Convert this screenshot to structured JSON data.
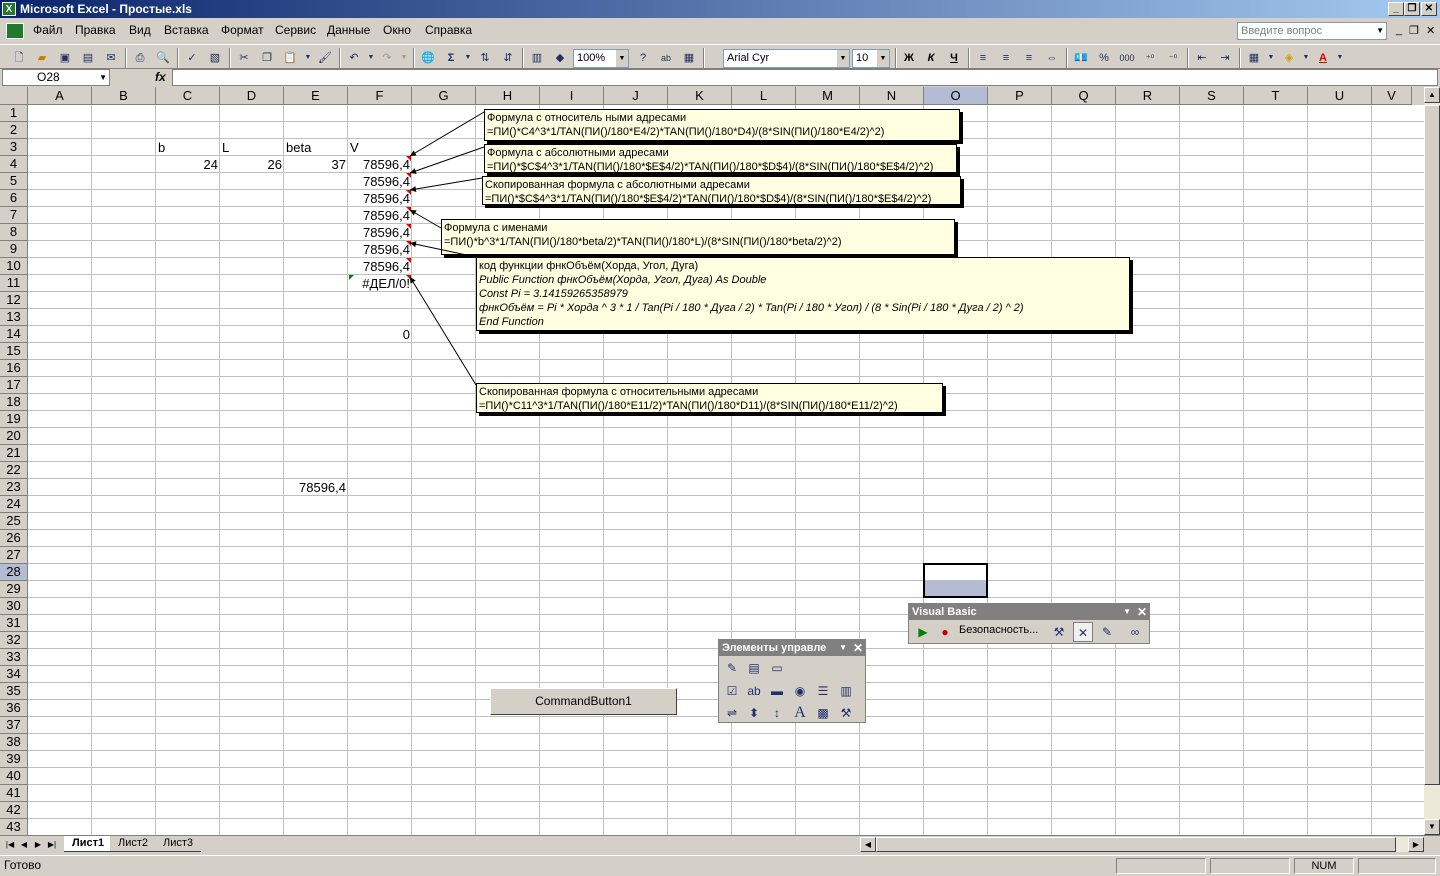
{
  "window": {
    "title": "Microsoft Excel - Простые.xls",
    "app_icon": "X"
  },
  "menu": [
    "Файл",
    "Правка",
    "Вид",
    "Вставка",
    "Формат",
    "Сервис",
    "Данные",
    "Окно",
    "Справка"
  ],
  "ask_placeholder": "Введите вопрос",
  "toolbar": {
    "zoom": "100%",
    "font_name": "Arial Cyr",
    "font_size": "10",
    "bold": "Ж",
    "italic": "К",
    "underline": "Ч",
    "percent": "%",
    "thousands": "000",
    "sigma": "Σ",
    "font_color_letter": "A"
  },
  "formula_bar": {
    "name_box": "O28",
    "fx": "fx",
    "formula": ""
  },
  "columns": [
    "A",
    "B",
    "C",
    "D",
    "E",
    "F",
    "G",
    "H",
    "I",
    "J",
    "K",
    "L",
    "M",
    "N",
    "O",
    "P",
    "Q",
    "R",
    "S",
    "T",
    "U",
    "V"
  ],
  "selected_column": "O",
  "rows": [
    "1",
    "2",
    "3",
    "4",
    "5",
    "6",
    "7",
    "8",
    "9",
    "10",
    "11",
    "12",
    "13",
    "14",
    "15",
    "16",
    "17",
    "18",
    "19",
    "20",
    "21",
    "22",
    "23",
    "24",
    "25",
    "26",
    "27",
    "28",
    "29",
    "30",
    "31",
    "32",
    "33",
    "34",
    "35",
    "36",
    "37",
    "38",
    "39",
    "40",
    "41",
    "42",
    "43"
  ],
  "selected_row": "28",
  "cells": {
    "C3": "b",
    "D3": "L",
    "E3": "beta",
    "F3": "V",
    "C4": "24",
    "D4": "26",
    "E4": "37",
    "F4": "78596,4",
    "F5": "78596,4",
    "F6": "78596,4",
    "F7": "78596,4",
    "F8": "78596,4",
    "F9": "78596,4",
    "F10": "78596,4",
    "F11": "#ДЕЛ/0!",
    "F14": "0",
    "E23": "78596,4"
  },
  "comments": [
    {
      "lines": [
        "Формула с относитель ными адресами",
        "=ПИ()*C4^3*1/TAN(ПИ()/180*E4/2)*TAN(ПИ()/180*D4)/(8*SIN(ПИ()/180*E4/2)^2)"
      ]
    },
    {
      "lines": [
        "Формула с абсолютными адресами",
        "=ПИ()*$C$4^3*1/TAN(ПИ()/180*$E$4/2)*TAN(ПИ()/180*$D$4)/(8*SIN(ПИ()/180*$E$4/2)^2)"
      ]
    },
    {
      "lines": [
        "Скопированная формула с абсолютными адресами",
        "=ПИ()*$C$4^3*1/TAN(ПИ()/180*$E$4/2)*TAN(ПИ()/180*$D$4)/(8*SIN(ПИ()/180*$E$4/2)^2)"
      ]
    },
    {
      "lines": [
        "Формула с именами",
        "=ПИ()*b^3*1/TAN(ПИ()/180*beta/2)*TAN(ПИ()/180*L)/(8*SIN(ПИ()/180*beta/2)^2)"
      ]
    },
    {
      "lines": [
        "код функции фнкОбъём(Хорда, Угол, Дуга)",
        "Public Function фнкОбъём(Хорда, Угол, Дуга) As Double",
        "Const Pi = 3.14159265358979",
        "фнкОбъём = Pi * Хорда ^ 3 * 1 / Tan(Pi / 180 * Дуга / 2) * Tan(Pi / 180 * Угол) / (8 * Sin(Pi / 180 * Дуга / 2) ^ 2)",
        "End Function"
      ]
    },
    {
      "lines": [
        "Скопированная формула с относительными адресами",
        "=ПИ()*C11^3*1/TAN(ПИ()/180*E11/2)*TAN(ПИ()/180*D11)/(8*SIN(ПИ()/180*E11/2)^2)"
      ]
    }
  ],
  "command_button": "CommandButton1",
  "vb_toolbar": {
    "title": "Visual Basic",
    "security": "Безопасность..."
  },
  "controls_toolbar": {
    "title": "Элементы управле"
  },
  "sheets": [
    "Лист1",
    "Лист2",
    "Лист3"
  ],
  "active_sheet": "Лист1",
  "status": {
    "text": "Готово",
    "num": "NUM"
  }
}
